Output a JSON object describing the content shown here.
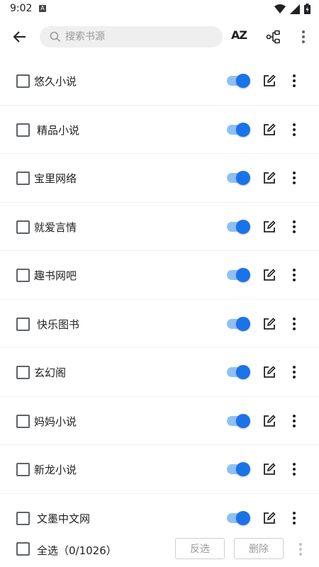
{
  "status_bar": {
    "time": "9:02",
    "notification_letter": "A"
  },
  "toolbar": {
    "search_placeholder": "搜索书源",
    "sort_label": "AZ"
  },
  "sources": [
    {
      "name": "悠久小说",
      "enabled": true
    },
    {
      "name": "精品小说",
      "enabled": true
    },
    {
      "name": "宝里网络",
      "enabled": true
    },
    {
      "name": "就爱言情",
      "enabled": true
    },
    {
      "name": "趣书网吧",
      "enabled": true
    },
    {
      "name": "快乐图书",
      "enabled": true
    },
    {
      "name": "玄幻阁",
      "enabled": true
    },
    {
      "name": "妈妈小说",
      "enabled": true
    },
    {
      "name": "新龙小说",
      "enabled": true
    },
    {
      "name": "文墨中文网",
      "enabled": true
    }
  ],
  "bottom_bar": {
    "select_all_label": "全选（0/1026）",
    "invert_label": "反选",
    "delete_label": "删除"
  },
  "colors": {
    "accent": "#1a73e8",
    "accent_light": "#8fc0f5"
  }
}
